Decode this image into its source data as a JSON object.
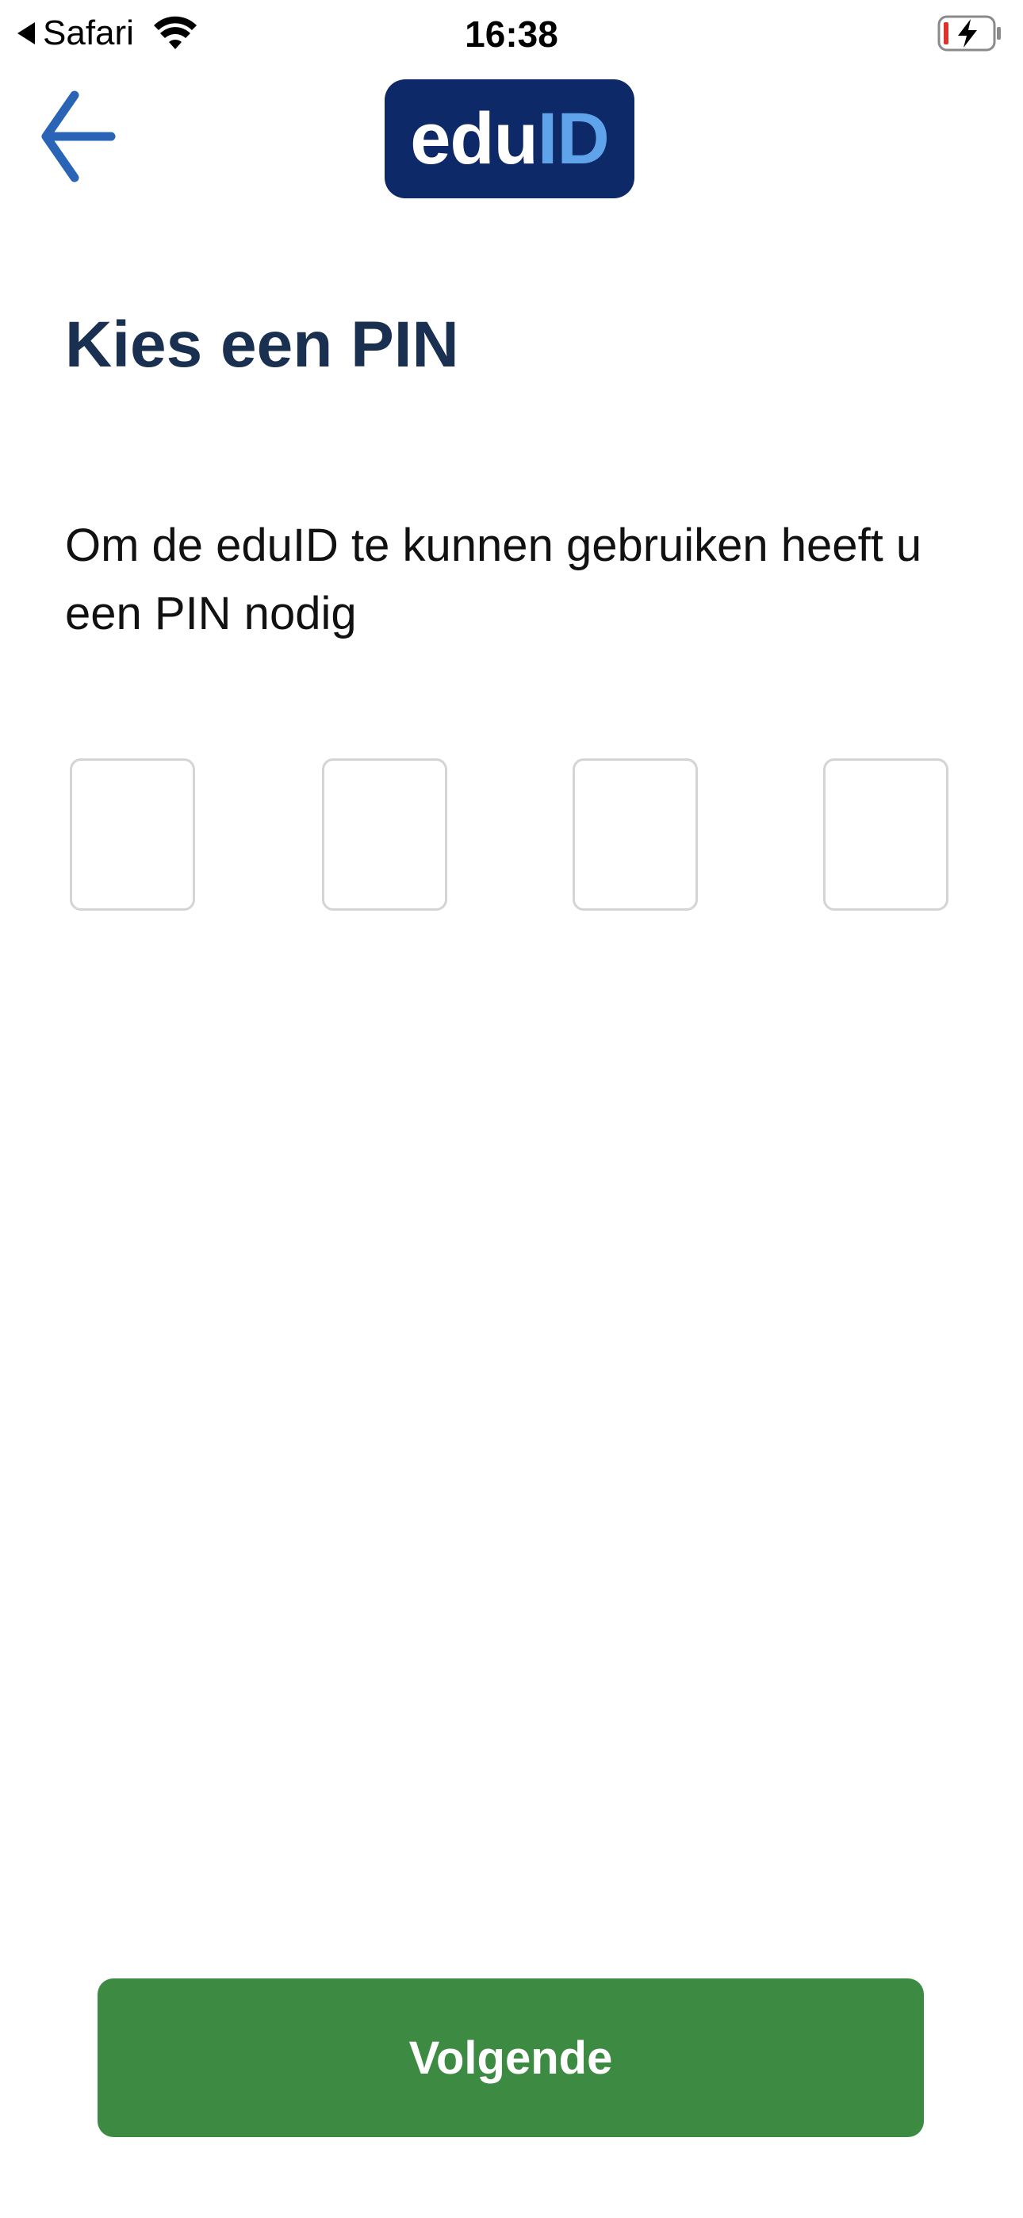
{
  "status_bar": {
    "back_app": "Safari",
    "time": "16:38"
  },
  "header": {
    "logo_part_a": "edu",
    "logo_part_b": "ID"
  },
  "main": {
    "title": "Kies een PIN",
    "intro": "Om de eduID te kunnen gebruiken heeft u een PIN nodig",
    "pin_fields": [
      "",
      "",
      "",
      ""
    ]
  },
  "footer": {
    "next_label": "Volgende"
  },
  "colors": {
    "logo_background": "#0e2967",
    "logo_accent": "#5fa3ea",
    "title_text": "#1a3050",
    "back_arrow": "#2a64b6",
    "button_background": "#3d8a43",
    "pin_border": "#d4d4d4"
  },
  "icons": {
    "status_back": "triangle-left-icon",
    "wifi": "wifi-icon",
    "battery": "battery-charging-icon",
    "back": "arrow-left-icon"
  }
}
